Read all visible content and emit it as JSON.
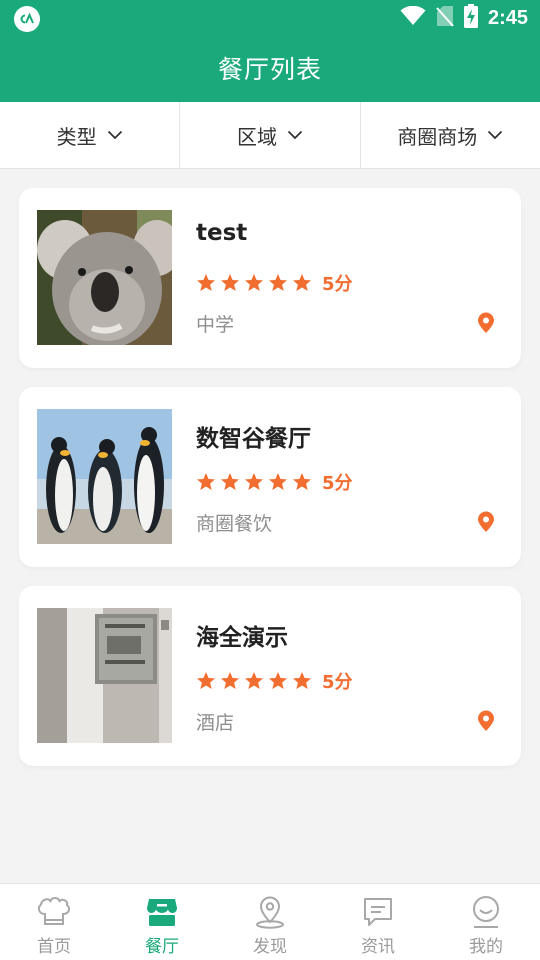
{
  "status_bar": {
    "time": "2:45"
  },
  "header": {
    "title": "餐厅列表"
  },
  "filters": [
    {
      "label": "类型"
    },
    {
      "label": "区域"
    },
    {
      "label": "商圈商场"
    }
  ],
  "restaurants": [
    {
      "name": "test",
      "rating_stars": 5,
      "score": "5分",
      "category": "中学",
      "image": "koala-photo"
    },
    {
      "name": "数智谷餐厅",
      "rating_stars": 5,
      "score": "5分",
      "category": "商圈餐饮",
      "image": "penguins-photo"
    },
    {
      "name": "海全演示",
      "rating_stars": 5,
      "score": "5分",
      "category": "酒店",
      "image": "office-door-photo"
    }
  ],
  "bottom_nav": [
    {
      "label": "首页",
      "icon": "home-chef-icon",
      "active": false
    },
    {
      "label": "餐厅",
      "icon": "store-icon",
      "active": true
    },
    {
      "label": "发现",
      "icon": "location-pin-icon",
      "active": false
    },
    {
      "label": "资讯",
      "icon": "message-icon",
      "active": false
    },
    {
      "label": "我的",
      "icon": "profile-smile-icon",
      "active": false
    }
  ],
  "colors": {
    "primary": "#1aa97a",
    "accent": "#f26d30",
    "muted_text": "#8e8e8e",
    "background": "#f3f3f3"
  }
}
